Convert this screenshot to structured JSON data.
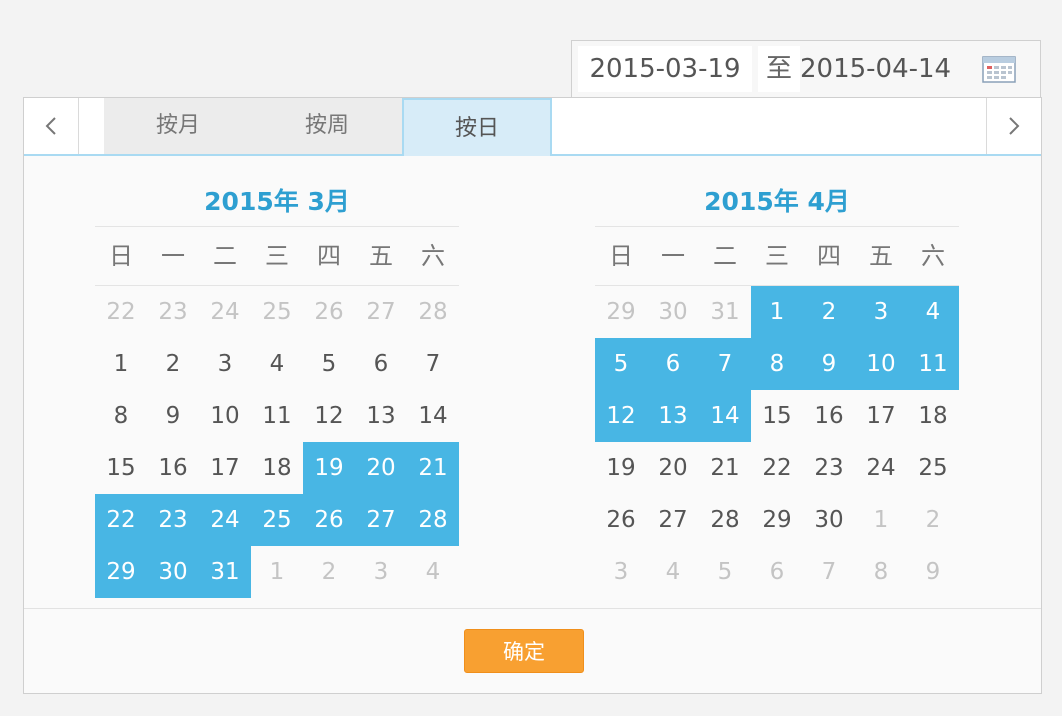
{
  "range": {
    "start": "2015-03-19",
    "separator": "至",
    "end": "2015-04-14",
    "icon": "calendar-icon"
  },
  "nav": {
    "prev_icon": "chevron-left-icon",
    "next_icon": "chevron-right-icon"
  },
  "tabs": [
    {
      "label": "按月",
      "active": false
    },
    {
      "label": "按周",
      "active": false
    },
    {
      "label": "按日",
      "active": true
    }
  ],
  "weekdays": [
    "日",
    "一",
    "二",
    "三",
    "四",
    "五",
    "六"
  ],
  "calendars": [
    {
      "title": "2015年  3月",
      "weeks": [
        [
          {
            "d": "22",
            "o": true
          },
          {
            "d": "23",
            "o": true
          },
          {
            "d": "24",
            "o": true
          },
          {
            "d": "25",
            "o": true
          },
          {
            "d": "26",
            "o": true
          },
          {
            "d": "27",
            "o": true
          },
          {
            "d": "28",
            "o": true
          }
        ],
        [
          {
            "d": "1"
          },
          {
            "d": "2"
          },
          {
            "d": "3"
          },
          {
            "d": "4"
          },
          {
            "d": "5"
          },
          {
            "d": "6"
          },
          {
            "d": "7"
          }
        ],
        [
          {
            "d": "8"
          },
          {
            "d": "9"
          },
          {
            "d": "10"
          },
          {
            "d": "11"
          },
          {
            "d": "12"
          },
          {
            "d": "13"
          },
          {
            "d": "14"
          }
        ],
        [
          {
            "d": "15"
          },
          {
            "d": "16"
          },
          {
            "d": "17"
          },
          {
            "d": "18"
          },
          {
            "d": "19",
            "s": true
          },
          {
            "d": "20",
            "s": true
          },
          {
            "d": "21",
            "s": true
          }
        ],
        [
          {
            "d": "22",
            "s": true
          },
          {
            "d": "23",
            "s": true
          },
          {
            "d": "24",
            "s": true
          },
          {
            "d": "25",
            "s": true
          },
          {
            "d": "26",
            "s": true
          },
          {
            "d": "27",
            "s": true
          },
          {
            "d": "28",
            "s": true
          }
        ],
        [
          {
            "d": "29",
            "s": true
          },
          {
            "d": "30",
            "s": true
          },
          {
            "d": "31",
            "s": true
          },
          {
            "d": "1",
            "o": true
          },
          {
            "d": "2",
            "o": true
          },
          {
            "d": "3",
            "o": true
          },
          {
            "d": "4",
            "o": true
          }
        ]
      ]
    },
    {
      "title": "2015年  4月",
      "weeks": [
        [
          {
            "d": "29",
            "o": true
          },
          {
            "d": "30",
            "o": true
          },
          {
            "d": "31",
            "o": true
          },
          {
            "d": "1",
            "s": true
          },
          {
            "d": "2",
            "s": true
          },
          {
            "d": "3",
            "s": true
          },
          {
            "d": "4",
            "s": true
          }
        ],
        [
          {
            "d": "5",
            "s": true
          },
          {
            "d": "6",
            "s": true
          },
          {
            "d": "7",
            "s": true
          },
          {
            "d": "8",
            "s": true
          },
          {
            "d": "9",
            "s": true
          },
          {
            "d": "10",
            "s": true
          },
          {
            "d": "11",
            "s": true
          }
        ],
        [
          {
            "d": "12",
            "s": true
          },
          {
            "d": "13",
            "s": true
          },
          {
            "d": "14",
            "s": true
          },
          {
            "d": "15"
          },
          {
            "d": "16"
          },
          {
            "d": "17"
          },
          {
            "d": "18"
          }
        ],
        [
          {
            "d": "19"
          },
          {
            "d": "20"
          },
          {
            "d": "21"
          },
          {
            "d": "22"
          },
          {
            "d": "23"
          },
          {
            "d": "24"
          },
          {
            "d": "25"
          }
        ],
        [
          {
            "d": "26"
          },
          {
            "d": "27"
          },
          {
            "d": "28"
          },
          {
            "d": "29"
          },
          {
            "d": "30"
          },
          {
            "d": "1",
            "o": true
          },
          {
            "d": "2",
            "o": true
          }
        ],
        [
          {
            "d": "3",
            "o": true
          },
          {
            "d": "4",
            "o": true
          },
          {
            "d": "5",
            "o": true
          },
          {
            "d": "6",
            "o": true
          },
          {
            "d": "7",
            "o": true
          },
          {
            "d": "8",
            "o": true
          },
          {
            "d": "9",
            "o": true
          }
        ]
      ]
    }
  ],
  "confirm_label": "确定",
  "colors": {
    "selected": "#48b6e4",
    "title": "#2e9fd1",
    "confirm": "#f8a031",
    "active_tab": "#d7ecf8"
  }
}
